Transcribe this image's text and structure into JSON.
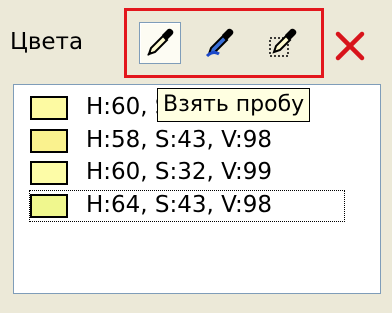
{
  "panel": {
    "label": "Цвета"
  },
  "toolbar": {
    "tools": [
      {
        "icon": "eyedropper-icon",
        "state": "pressed"
      },
      {
        "icon": "eyedropper-blue-icon"
      },
      {
        "icon": "eyedropper-dotted-icon"
      }
    ],
    "close_icon": "close-icon",
    "highlight_color": "#e3171d"
  },
  "tooltip": {
    "text": "Взять пробу"
  },
  "colors": [
    {
      "label": "H:60, S:32, V:99",
      "swatch": "#fdfaa2"
    },
    {
      "label": "H:58, S:43, V:98",
      "swatch": "#faf28e"
    },
    {
      "label": "H:60, S:32, V:99",
      "swatch": "#fdfca7"
    },
    {
      "label": "H:64, S:43, V:98",
      "swatch": "#f0f78e",
      "selected": true
    }
  ]
}
